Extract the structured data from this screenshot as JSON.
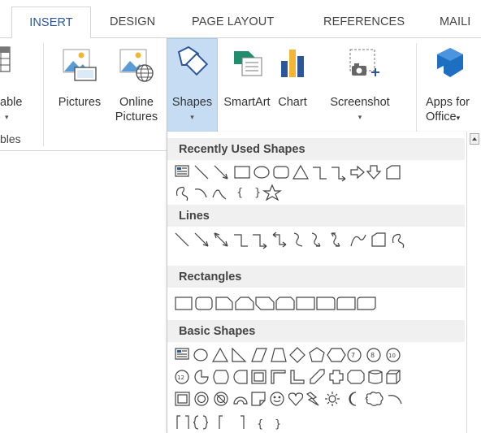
{
  "tabs": [
    "INSERT",
    "DESIGN",
    "PAGE LAYOUT",
    "REFERENCES",
    "MAILI"
  ],
  "ribbon": {
    "table_label": "able",
    "table_group_label": "bles",
    "pictures_label": "Pictures",
    "online_pictures_line1": "Online",
    "online_pictures_line2": "Pictures",
    "shapes_label": "Shapes",
    "smartart_label": "SmartArt",
    "chart_label": "Chart",
    "screenshot_label": "Screenshot",
    "apps_line1": "Apps for",
    "apps_line2": "Office",
    "dropdown_arrow": "▾"
  },
  "shapes_panel": {
    "sections": [
      "Recently Used Shapes",
      "Lines",
      "Rectangles",
      "Basic Shapes"
    ]
  },
  "colors": {
    "accent": "#2b579a",
    "highlight": "#c5dcf2",
    "shape_stroke": "#444444",
    "section_bg": "#f0f0f0"
  }
}
